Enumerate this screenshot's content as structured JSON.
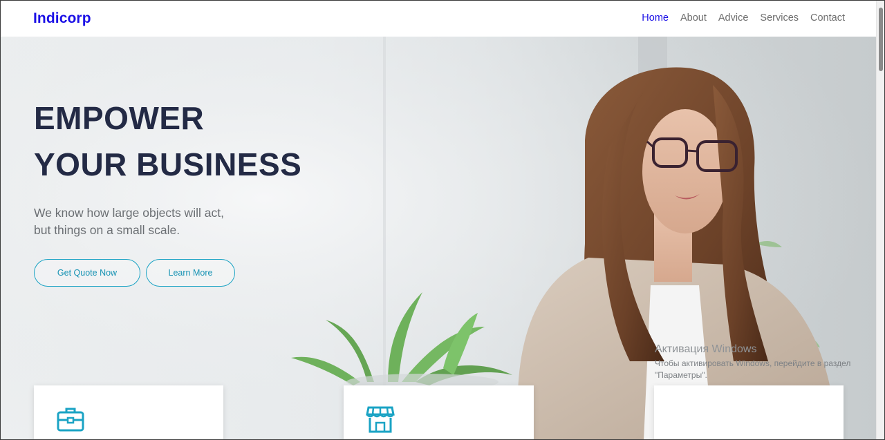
{
  "header": {
    "logo": "Indicorp",
    "nav": [
      "Home",
      "About",
      "Advice",
      "Services",
      "Contact"
    ],
    "active_nav": "Home"
  },
  "hero": {
    "title_line1": "EMPOWER",
    "title_line2": "YOUR BUSINESS",
    "subtitle_line1": "We know how large objects will act,",
    "subtitle_line2": "but things on a small scale.",
    "primary_button": "Get Quote Now",
    "secondary_button": "Learn More"
  },
  "cards": [
    {
      "icon": "briefcase-icon"
    },
    {
      "icon": "storefront-icon"
    },
    {
      "icon": ""
    }
  ],
  "windows_watermark": {
    "title": "Активация Windows",
    "text_line1": "Чтобы активировать Windows, перейдите в раздел",
    "text_line2": "\"Параметры\"."
  },
  "colors": {
    "brand": "#1b10e6",
    "accent": "#1aa3c4",
    "heading": "#232a45",
    "nav_text": "#6f6f6f"
  }
}
